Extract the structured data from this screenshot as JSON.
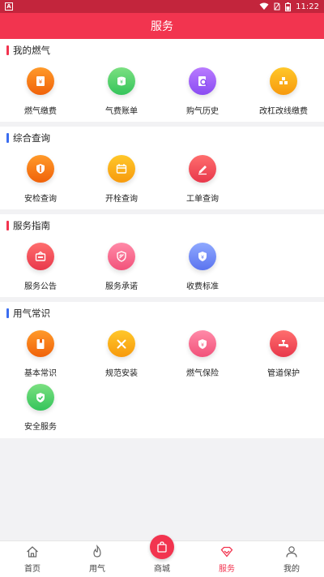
{
  "status_bar": {
    "time": "11:22"
  },
  "header": {
    "title": "服务"
  },
  "colors": {
    "accent": "#f2344f",
    "status_bar": "#c3253c",
    "section_bar_red": "#f2344f",
    "section_bar_blue": "#3b6df0"
  },
  "sections": [
    {
      "title": "我的燃气",
      "items": [
        {
          "label": "燃气缴费",
          "icon": "yuan-card-icon"
        },
        {
          "label": "气费账单",
          "icon": "bill-icon"
        },
        {
          "label": "购气历史",
          "icon": "history-icon"
        },
        {
          "label": "改杠改线缴费",
          "icon": "pipe-blocks-icon"
        }
      ]
    },
    {
      "title": "综合查询",
      "items": [
        {
          "label": "安检查询",
          "icon": "shield-icon"
        },
        {
          "label": "开栓查询",
          "icon": "calendar-icon"
        },
        {
          "label": "工单查询",
          "icon": "edit-icon"
        }
      ]
    },
    {
      "title": "服务指南",
      "items": [
        {
          "label": "服务公告",
          "icon": "announcement-icon"
        },
        {
          "label": "服务承诺",
          "icon": "badge-icon"
        },
        {
          "label": "收费标准",
          "icon": "price-shield-icon"
        }
      ]
    },
    {
      "title": "用气常识",
      "items": [
        {
          "label": "基本常识",
          "icon": "book-icon"
        },
        {
          "label": "规范安装",
          "icon": "tools-icon"
        },
        {
          "label": "燃气保险",
          "icon": "insurance-icon"
        },
        {
          "label": "管道保护",
          "icon": "faucet-icon"
        },
        {
          "label": "安全服务",
          "icon": "safety-shield-icon"
        }
      ]
    }
  ],
  "bottom_nav": [
    {
      "label": "首页",
      "icon": "home-icon"
    },
    {
      "label": "用气",
      "icon": "flame-icon"
    },
    {
      "label": "商城",
      "icon": "shopping-bag-icon"
    },
    {
      "label": "服务",
      "icon": "diamond-icon",
      "active": true
    },
    {
      "label": "我的",
      "icon": "user-icon"
    }
  ]
}
